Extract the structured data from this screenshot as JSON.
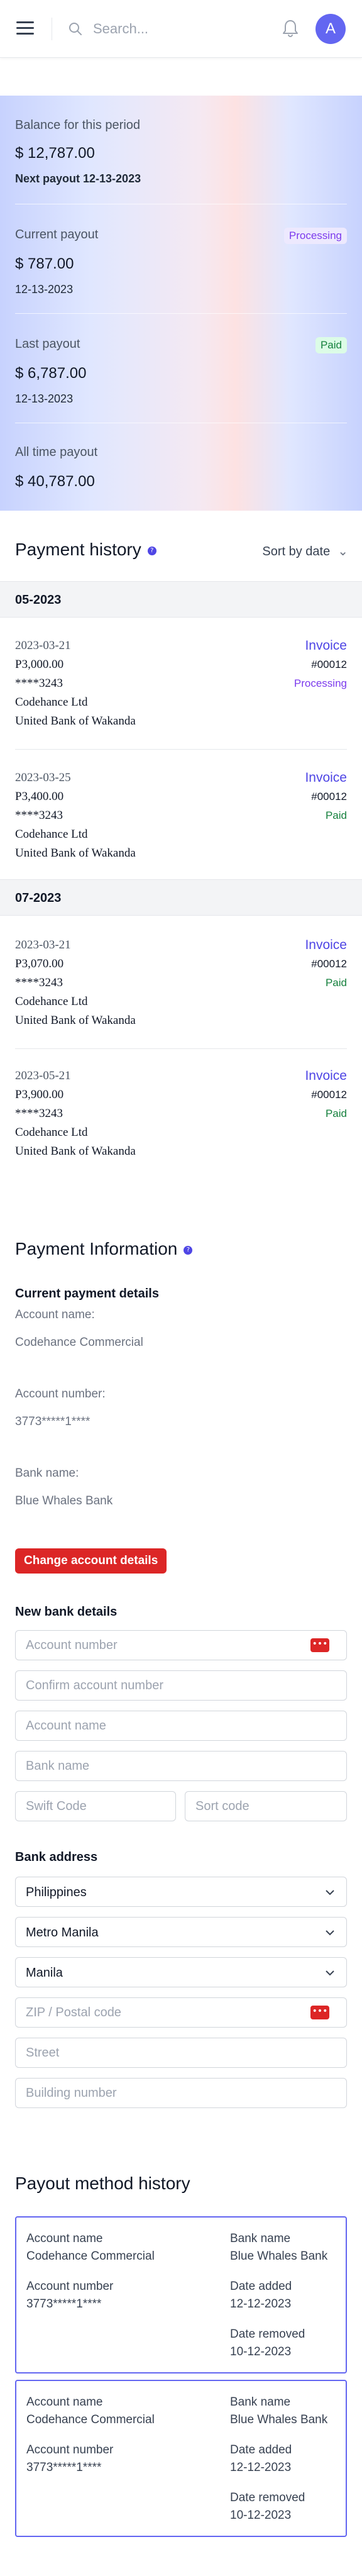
{
  "header": {
    "search_placeholder": "Search...",
    "avatar_initial": "A"
  },
  "summary": {
    "balance_label": "Balance for this period",
    "balance_amount": "$ 12,787.00",
    "next_payout": "Next payout 12-13-2023",
    "current_label": "Current payout",
    "current_status": "Processing",
    "current_amount": "$ 787.00",
    "current_date": "12-13-2023",
    "last_label": "Last payout",
    "last_status": "Paid",
    "last_amount": "$ 6,787.00",
    "last_date": "12-13-2023",
    "alltime_label": "All time payout",
    "alltime_amount": "$ 40,787.00"
  },
  "payment_history": {
    "title": "Payment history",
    "sort_label": "Sort by date",
    "groups": [
      {
        "label": "05-2023",
        "items": [
          {
            "date": "2023-03-21",
            "amount": "P3,000.00",
            "card": "****3243",
            "company": "Codehance Ltd",
            "bank": "United Bank of Wakanda",
            "invoice_label": "Invoice",
            "invoice_no": "#00012",
            "status": "Processing"
          },
          {
            "date": "2023-03-25",
            "amount": "P3,400.00",
            "card": "****3243",
            "company": "Codehance Ltd",
            "bank": "United Bank of Wakanda",
            "invoice_label": "Invoice",
            "invoice_no": "#00012",
            "status": "Paid"
          }
        ]
      },
      {
        "label": "07-2023",
        "items": [
          {
            "date": "2023-03-21",
            "amount": "P3,070.00",
            "card": "****3243",
            "company": "Codehance Ltd",
            "bank": "United Bank of Wakanda",
            "invoice_label": "Invoice",
            "invoice_no": "#00012",
            "status": "Paid"
          },
          {
            "date": "2023-05-21",
            "amount": "P3,900.00",
            "card": "****3243",
            "company": "Codehance Ltd",
            "bank": "United Bank of Wakanda",
            "invoice_label": "Invoice",
            "invoice_no": "#00012",
            "status": "Paid"
          }
        ]
      }
    ]
  },
  "payment_info": {
    "title": "Payment Information",
    "current_heading": "Current payment details",
    "account_name_label": "Account name:",
    "account_name_value": "Codehance Commercial",
    "account_number_label": "Account number:",
    "account_number_value": "3773*****1****",
    "bank_name_label": "Bank name:",
    "bank_name_value": "Blue Whales Bank",
    "change_button": "Change account details",
    "new_bank_heading": "New bank details",
    "ph_account_number": "Account number",
    "ph_confirm_account_number": "Confirm account number",
    "ph_account_name": "Account name",
    "ph_bank_name": "Bank name",
    "ph_swift": "Swift Code",
    "ph_sort": "Sort code",
    "address_heading": "Bank address",
    "country": "Philippines",
    "region": "Metro Manila",
    "city": "Manila",
    "ph_zip": "ZIP / Postal code",
    "ph_street": "Street",
    "ph_building": "Building number"
  },
  "payout_method_history": {
    "title": "Payout method history",
    "cards": [
      {
        "account_name_label": "Account name",
        "account_name": "Codehance Commercial",
        "account_number_label": "Account number",
        "account_number": "3773*****1****",
        "bank_name_label": "Bank name",
        "bank_name": "Blue Whales Bank",
        "date_added_label": "Date added",
        "date_added": "12-12-2023",
        "date_removed_label": "Date removed",
        "date_removed": "10-12-2023"
      },
      {
        "account_name_label": "Account name",
        "account_name": "Codehance Commercial",
        "account_number_label": "Account number",
        "account_number": "3773*****1****",
        "bank_name_label": "Bank name",
        "bank_name": "Blue Whales Bank",
        "date_added_label": "Date added",
        "date_added": "12-12-2023",
        "date_removed_label": "Date removed",
        "date_removed": "10-12-2023"
      }
    ]
  },
  "colors": {
    "accent": "#4f46e5",
    "processing": "#7c3aed",
    "paid": "#15803d",
    "danger": "#dc2626"
  }
}
